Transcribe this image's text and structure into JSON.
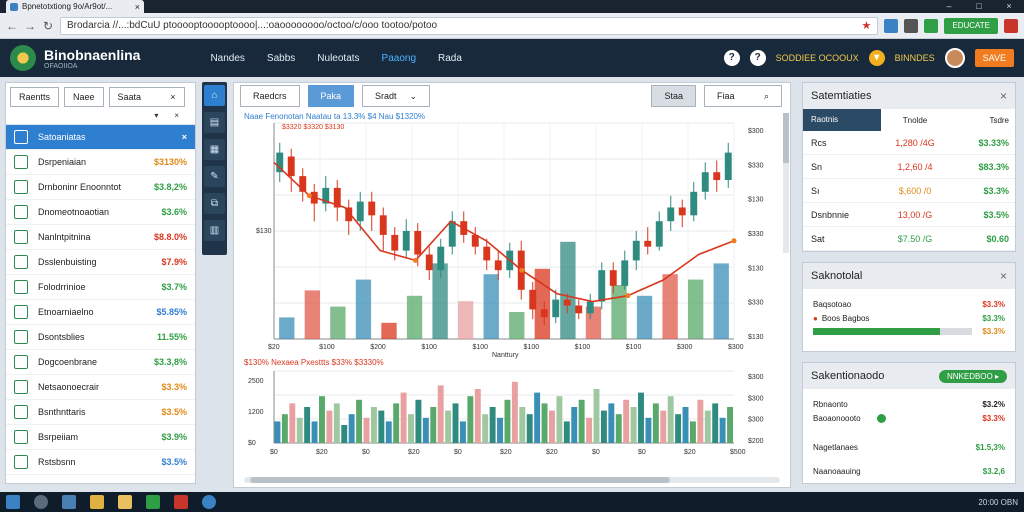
{
  "browser": {
    "tab_title": "Bpnetotxtiong 9o/Ar9ot/...",
    "address": "Brodarcia //...:bdCuU ptooooptooooptoooo|...:oaoooooooo/octoo/c/ooo tootoo/potoo",
    "extension_label": "EDUCATE"
  },
  "header": {
    "brand": "Binobnaenlina",
    "brand_sub": "OFAOIIOA",
    "nav": [
      "Nandes",
      "Sabbs",
      "Nuleotats",
      "Paaong",
      "Rada"
    ],
    "active_nav": 3,
    "help_icon_1": "?",
    "help_icon_2": "?",
    "right_text": "SODDIEE OCOOUX",
    "coin_label": "BINNDES",
    "cta": "SAVE"
  },
  "watchlist": {
    "filter_1": "Raentts",
    "filter_2": "Naee",
    "search_value": "Saata",
    "clear": "×",
    "sort_1": "▾",
    "sort_2": "×",
    "items": [
      {
        "name": "Satoaniatas",
        "value": "×",
        "color": "w"
      },
      {
        "name": "Dsrpeniaian",
        "value": "$3130%",
        "color": "o"
      },
      {
        "name": "Drnboninr Enoonntot",
        "value": "$3.8,2%",
        "color": "g"
      },
      {
        "name": "Dnomeotnoaotian",
        "value": "$3.6%",
        "color": "g"
      },
      {
        "name": "Nanlntpitnina",
        "value": "$8.8.0%",
        "color": "r"
      },
      {
        "name": "Dsslenbuisting",
        "value": "$7.9%",
        "color": "r"
      },
      {
        "name": "Folodrrinioe",
        "value": "$3.7%",
        "color": "g"
      },
      {
        "name": "Etnoarniaelno",
        "value": "$5.85%",
        "color": "b"
      },
      {
        "name": "Dsontsblies",
        "value": "11.55%",
        "color": "g"
      },
      {
        "name": "Dogcoenbrane",
        "value": "$3.3,8%",
        "color": "g"
      },
      {
        "name": "Netsaonoecrair",
        "value": "$3.3%",
        "color": "o"
      },
      {
        "name": "Bsnthnttaris",
        "value": "$3.5%",
        "color": "o"
      },
      {
        "name": "Bsrpeiiam",
        "value": "$3.9%",
        "color": "g"
      },
      {
        "name": "Rstsbsnn",
        "value": "$3.5%",
        "color": "b"
      }
    ]
  },
  "chart_toolbar": {
    "btn_1": "Raedcrs",
    "btn_2": "Paka",
    "dropdown": "Sradt",
    "btn_gray": "Staa",
    "search": "Fiaa",
    "search_icon": "⌕"
  },
  "chart_data": [
    {
      "type": "candlestick",
      "legend": "Naae Fenonotan Naatau ta 13.3% $4 Nau $1320%",
      "legend_sub": "$3320  $3320  $3130",
      "ylabel": "$130",
      "right_ticks": [
        "$300",
        "$330",
        "$130",
        "$330",
        "$130",
        "$330",
        "$130"
      ],
      "x_ticks": [
        "$20",
        "$100",
        "$200",
        "$100",
        "$100",
        "$100",
        "$100",
        "$100",
        "$300",
        "$300"
      ],
      "xlabel": "Nanttury",
      "candles": [
        {
          "o": 0.8,
          "c": 0.9,
          "h": 0.95,
          "l": 0.75
        },
        {
          "o": 0.88,
          "c": 0.78,
          "h": 0.92,
          "l": 0.7
        },
        {
          "o": 0.78,
          "c": 0.7,
          "h": 0.82,
          "l": 0.65
        },
        {
          "o": 0.7,
          "c": 0.64,
          "h": 0.74,
          "l": 0.55
        },
        {
          "o": 0.64,
          "c": 0.72,
          "h": 0.78,
          "l": 0.6
        },
        {
          "o": 0.72,
          "c": 0.62,
          "h": 0.76,
          "l": 0.55
        },
        {
          "o": 0.62,
          "c": 0.55,
          "h": 0.66,
          "l": 0.48
        },
        {
          "o": 0.55,
          "c": 0.65,
          "h": 0.7,
          "l": 0.5
        },
        {
          "o": 0.65,
          "c": 0.58,
          "h": 0.7,
          "l": 0.5
        },
        {
          "o": 0.58,
          "c": 0.48,
          "h": 0.62,
          "l": 0.4
        },
        {
          "o": 0.48,
          "c": 0.4,
          "h": 0.52,
          "l": 0.35
        },
        {
          "o": 0.4,
          "c": 0.5,
          "h": 0.56,
          "l": 0.36
        },
        {
          "o": 0.5,
          "c": 0.38,
          "h": 0.54,
          "l": 0.32
        },
        {
          "o": 0.38,
          "c": 0.3,
          "h": 0.42,
          "l": 0.25
        },
        {
          "o": 0.3,
          "c": 0.42,
          "h": 0.46,
          "l": 0.26
        },
        {
          "o": 0.42,
          "c": 0.55,
          "h": 0.6,
          "l": 0.38
        },
        {
          "o": 0.55,
          "c": 0.48,
          "h": 0.6,
          "l": 0.44
        },
        {
          "o": 0.48,
          "c": 0.42,
          "h": 0.52,
          "l": 0.38
        },
        {
          "o": 0.42,
          "c": 0.35,
          "h": 0.46,
          "l": 0.3
        },
        {
          "o": 0.35,
          "c": 0.3,
          "h": 0.4,
          "l": 0.25
        },
        {
          "o": 0.3,
          "c": 0.4,
          "h": 0.44,
          "l": 0.26
        },
        {
          "o": 0.4,
          "c": 0.2,
          "h": 0.45,
          "l": 0.15
        },
        {
          "o": 0.2,
          "c": 0.1,
          "h": 0.24,
          "l": 0.05
        },
        {
          "o": 0.1,
          "c": 0.06,
          "h": 0.14,
          "l": 0.02
        },
        {
          "o": 0.06,
          "c": 0.15,
          "h": 0.2,
          "l": 0.03
        },
        {
          "o": 0.15,
          "c": 0.12,
          "h": 0.18,
          "l": 0.08
        },
        {
          "o": 0.12,
          "c": 0.08,
          "h": 0.15,
          "l": 0.05
        },
        {
          "o": 0.08,
          "c": 0.14,
          "h": 0.18,
          "l": 0.05
        },
        {
          "o": 0.14,
          "c": 0.3,
          "h": 0.34,
          "l": 0.1
        },
        {
          "o": 0.3,
          "c": 0.22,
          "h": 0.34,
          "l": 0.18
        },
        {
          "o": 0.22,
          "c": 0.35,
          "h": 0.4,
          "l": 0.2
        },
        {
          "o": 0.35,
          "c": 0.45,
          "h": 0.5,
          "l": 0.3
        },
        {
          "o": 0.45,
          "c": 0.42,
          "h": 0.52,
          "l": 0.38
        },
        {
          "o": 0.42,
          "c": 0.55,
          "h": 0.6,
          "l": 0.4
        },
        {
          "o": 0.55,
          "c": 0.62,
          "h": 0.68,
          "l": 0.5
        },
        {
          "o": 0.62,
          "c": 0.58,
          "h": 0.66,
          "l": 0.52
        },
        {
          "o": 0.58,
          "c": 0.7,
          "h": 0.75,
          "l": 0.55
        },
        {
          "o": 0.7,
          "c": 0.8,
          "h": 0.85,
          "l": 0.66
        },
        {
          "o": 0.8,
          "c": 0.76,
          "h": 0.86,
          "l": 0.7
        },
        {
          "o": 0.76,
          "c": 0.9,
          "h": 0.95,
          "l": 0.72
        }
      ],
      "ma": [
        0.85,
        0.68,
        0.62,
        0.4,
        0.35,
        0.55,
        0.45,
        0.3,
        0.18,
        0.14,
        0.17,
        0.25,
        0.38,
        0.45
      ],
      "overlay_bars": [
        {
          "v": 0.2,
          "c": "#3a8fb7"
        },
        {
          "v": 0.45,
          "c": "#e05a4a"
        },
        {
          "v": 0.3,
          "c": "#5aa86a"
        },
        {
          "v": 0.55,
          "c": "#3a8fb7"
        },
        {
          "v": 0.15,
          "c": "#d9361e"
        },
        {
          "v": 0.4,
          "c": "#5aa86a"
        },
        {
          "v": 0.7,
          "c": "#2f8a80"
        },
        {
          "v": 0.35,
          "c": "#e8a0a0"
        },
        {
          "v": 0.6,
          "c": "#3a8fb7"
        },
        {
          "v": 0.25,
          "c": "#5aa86a"
        },
        {
          "v": 0.65,
          "c": "#d9361e"
        },
        {
          "v": 0.9,
          "c": "#2f8a80"
        },
        {
          "v": 0.3,
          "c": "#e05a4a"
        },
        {
          "v": 0.5,
          "c": "#5aa86a"
        },
        {
          "v": 0.4,
          "c": "#3a8fb7"
        },
        {
          "v": 0.6,
          "c": "#e05a4a"
        },
        {
          "v": 0.55,
          "c": "#5aa86a"
        },
        {
          "v": 0.7,
          "c": "#3a8fb7"
        }
      ]
    },
    {
      "type": "bar",
      "legend": "$130%  Nexaea Pxesttts $33% $3330%",
      "y_ticks": [
        "2500",
        "1200",
        "$0"
      ],
      "right_ticks": [
        "$300",
        "$300",
        "$300",
        "$200"
      ],
      "x_ticks": [
        "$0",
        "$20",
        "$0",
        "$20",
        "$0",
        "$20",
        "$20",
        "$0",
        "$0",
        "$20",
        "$500"
      ],
      "values": [
        0.3,
        0.4,
        0.55,
        0.35,
        0.5,
        0.3,
        0.65,
        0.45,
        0.55,
        0.25,
        0.4,
        0.6,
        0.35,
        0.5,
        0.45,
        0.3,
        0.55,
        0.7,
        0.4,
        0.6,
        0.35,
        0.5,
        0.8,
        0.45,
        0.55,
        0.3,
        0.65,
        0.75,
        0.4,
        0.5,
        0.35,
        0.6,
        0.85,
        0.5,
        0.4,
        0.7,
        0.55,
        0.45,
        0.65,
        0.3,
        0.5,
        0.6,
        0.35,
        0.75,
        0.45,
        0.55,
        0.4,
        0.6,
        0.5,
        0.7,
        0.35,
        0.55,
        0.45,
        0.65,
        0.4,
        0.5,
        0.3,
        0.6,
        0.45,
        0.55,
        0.35,
        0.5
      ],
      "colors": [
        "#3a8fb7",
        "#5aa86a",
        "#e8a0a0",
        "#9fc7a0",
        "#2f8a80"
      ]
    }
  ],
  "stats_panel": {
    "title": "Satemtiaties",
    "close": "×",
    "headers": [
      "Raotnis",
      "Tnolde",
      "Tsdre"
    ],
    "rows": [
      {
        "a": "Rcs",
        "b": "1,280 /4G",
        "c": "$3.33%",
        "bc": "r"
      },
      {
        "a": "Sn",
        "b": "1,2,60 /4",
        "c": "$83.3%",
        "bc": "r"
      },
      {
        "a": "Sı",
        "b": "$,600 /0",
        "c": "$3.3%",
        "bc": "o"
      },
      {
        "a": "Dsnbnnie",
        "b": "13,00 /G",
        "c": "$3.5%",
        "bc": "r"
      },
      {
        "a": "Sat",
        "b": "$7.50 /G",
        "c": "$0.60",
        "bc": "g"
      }
    ]
  },
  "movers_panel": {
    "title": "Saknotolal",
    "close": "×",
    "row1_label": "Baqsotoao",
    "row1_value": "$3.3%",
    "row2_label": "Boos Bagbos",
    "row2_value": "$3.3%",
    "bar_label": "$3.3%",
    "bar_fill": 0.8
  },
  "orders_panel": {
    "title": "Sakentionaodo",
    "pill": "NNKEDBOO ▸",
    "row1_label": "Rbnaonto",
    "row1_value": "$3.2%",
    "row2_label": "Baoaonoooto",
    "row2_value": "$3.3%",
    "row3_label": "Nagetlanaes",
    "row3_value": "$1.5,3%",
    "row4_label": "Naanoaauing",
    "row4_value": "$3.2,6"
  },
  "taskbar": {
    "clock": "20:00 OBN"
  }
}
